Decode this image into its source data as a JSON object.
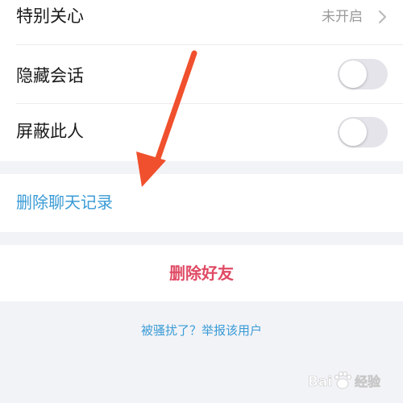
{
  "settings": {
    "special_care": {
      "label": "特别关心",
      "value": "未开启"
    },
    "hide_chat": {
      "label": "隐藏会话",
      "enabled": false
    },
    "block_person": {
      "label": "屏蔽此人",
      "enabled": false
    }
  },
  "actions": {
    "delete_chat_history": "删除聊天记录",
    "delete_friend": "删除好友",
    "report_user": "被骚扰了？举报该用户"
  },
  "annotation": {
    "arrow_color": "#f0502d"
  },
  "watermark": {
    "text": "Baidu 经验"
  },
  "colors": {
    "link_blue": "#3a9bd6",
    "danger_red": "#e04a64",
    "background": "#f2f3f7",
    "toggle_off": "#e4e4ea"
  }
}
